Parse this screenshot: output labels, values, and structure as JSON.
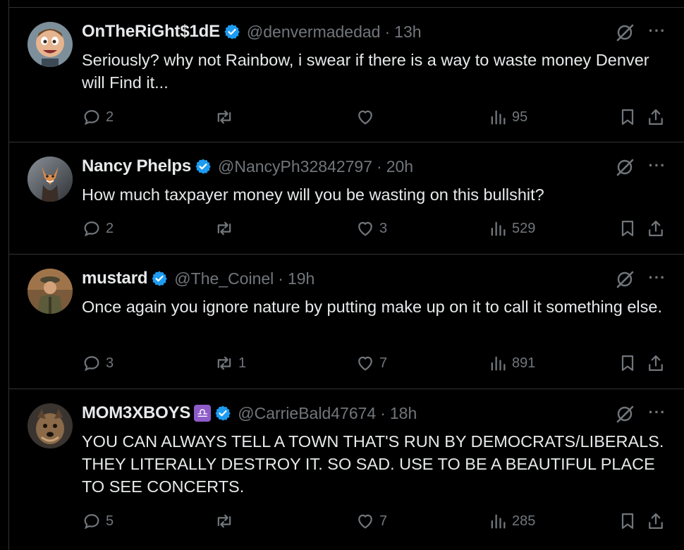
{
  "tweets": [
    {
      "name": "OnTheRiGht$1dE",
      "has_zodiac_badge": false,
      "handle": "@denvermadedad",
      "time": "13h",
      "text": "Seriously? why not Rainbow, i swear if there is a way to waste money Denver will Find it...",
      "replies": "2",
      "retweets": "",
      "likes": "",
      "views": "95",
      "avatar_icon": "cartoon-face-avatar"
    },
    {
      "name": "Nancy Phelps",
      "has_zodiac_badge": false,
      "handle": "@NancyPh32842797",
      "time": "20h",
      "text": "How much taxpayer money will you be wasting on this bullshit?",
      "replies": "2",
      "retweets": "",
      "likes": "3",
      "views": "529",
      "avatar_icon": "fox-avatar"
    },
    {
      "name": "mustard",
      "has_zodiac_badge": false,
      "handle": "@The_Coinel",
      "time": "19h",
      "text": "Once again you ignore nature by putting make up on it to call it something else.",
      "replies": "3",
      "retweets": "1",
      "likes": "7",
      "views": "891",
      "avatar_icon": "soldier-avatar"
    },
    {
      "name": "MOM3XBOYS",
      "has_zodiac_badge": true,
      "zodiac_symbol": "♎",
      "handle": "@CarrieBald47674",
      "time": "18h",
      "text": "YOU CAN ALWAYS TELL A TOWN THAT'S RUN BY DEMOCRATS/LIBERALS. THEY LITERALLY DESTROY IT. SO SAD. USE TO BE A BEAUTIFUL PLACE TO SEE CONCERTS.",
      "replies": "5",
      "retweets": "",
      "likes": "7",
      "views": "285",
      "avatar_icon": "dog-avatar"
    }
  ],
  "colors": {
    "background": "#000000",
    "text": "#e7e9ea",
    "muted": "#71767b",
    "verified": "#1d9bf0",
    "border": "#2f3336",
    "zodiac": "#8e5cc9"
  }
}
